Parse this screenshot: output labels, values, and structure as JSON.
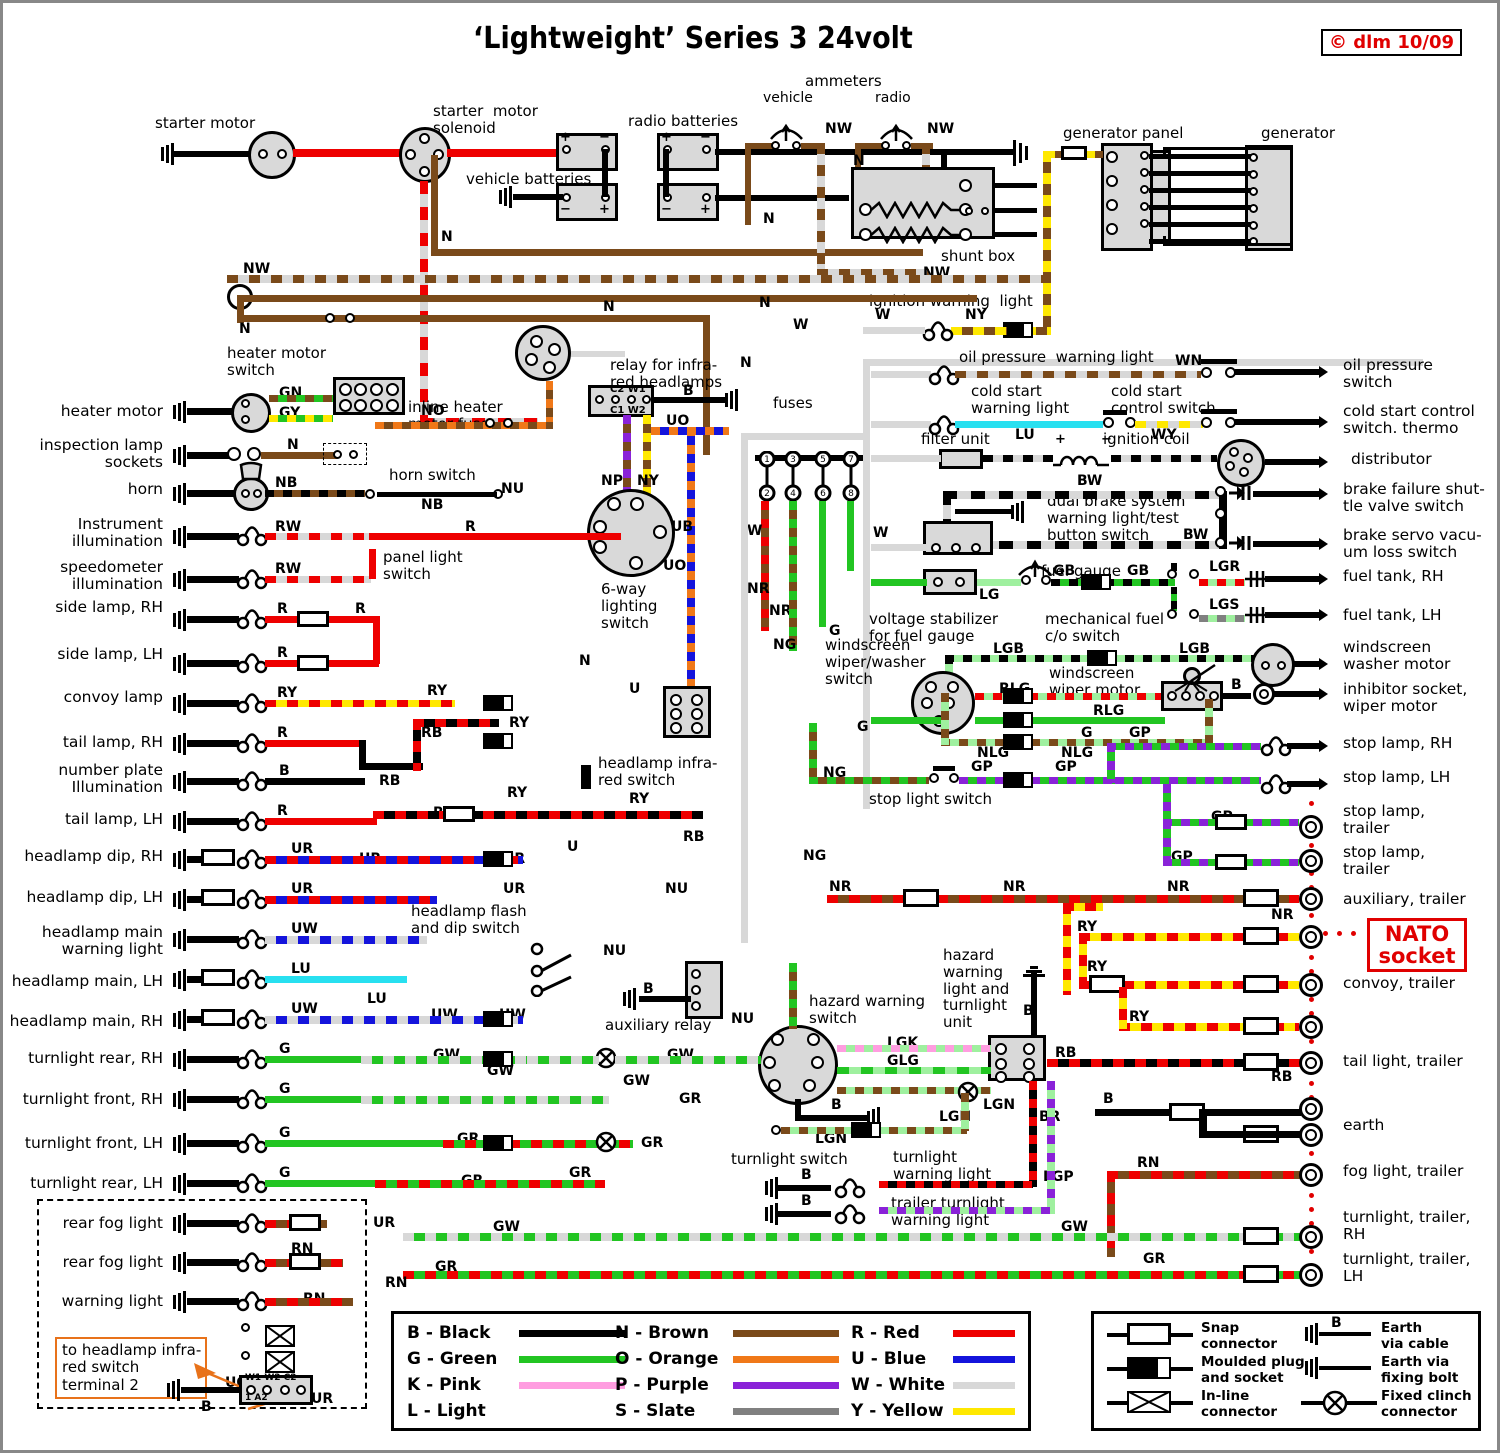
{
  "title": "‘Lightweight’ Series 3 24volt",
  "copyright": "© dlm 10/09",
  "top_components": {
    "starter_motor": "starter motor",
    "starter_motor_solenoid": "starter  motor\nsolenoid",
    "vehicle_batteries": "vehicle batteries",
    "radio_batteries": "radio batteries",
    "ammeters": "ammeters",
    "ammeter_vehicle": "vehicle",
    "ammeter_radio": "radio",
    "shunt_box": "shunt box",
    "generator_panel": "generator panel",
    "generator": "generator",
    "ignition_warning_light": "ignition warning  light"
  },
  "left_labels": [
    "heater motor",
    "inspection lamp\nsockets",
    "horn",
    "Instrument\nillumination",
    "speedometer\nillumination",
    "side lamp, RH",
    "side lamp, LH",
    "convoy lamp",
    "tail lamp, RH",
    "number plate\nIllumination",
    "tail lamp, LH",
    "headlamp dip, RH",
    "headlamp dip, LH",
    "headlamp main\nwarning light",
    "headlamp main, LH",
    "headlamp main, RH",
    "turnlight rear, RH",
    "turnlight front, RH",
    "turnlight front, LH",
    "turnlight rear, LH",
    "rear fog light",
    "rear fog light",
    "warning light"
  ],
  "right_labels": [
    "oil pressure\nswitch",
    "cold start control\nswitch. thermo",
    "distributor",
    "brake failure shut-\ntle valve switch",
    "brake servo vacu-\num loss switch",
    "fuel tank, RH",
    "fuel tank, LH",
    "windscreen\nwasher motor",
    "inhibitor socket,\nwiper motor",
    "stop lamp, RH",
    "stop lamp, LH",
    "stop lamp,\ntrailer",
    "stop lamp,\ntrailer",
    "auxiliary, trailer",
    "convoy, trailer",
    "tail light, trailer",
    "earth",
    "fog light, trailer",
    "turnlight, trailer,\nRH",
    "turnlight, trailer,\nLH"
  ],
  "nato_socket": "NATO\nsocket",
  "center_components": [
    "heater motor\nswitch",
    "inline heater\nmotor fuse",
    "relay for infra-\nred headlamps",
    "horn switch",
    "panel light\nswitch",
    "6-way\nlighting\nswitch",
    "headlamp infra-\nred switch",
    "fuses",
    "headlamp flash\nand dip switch",
    "auxiliary relay",
    "hazard warning\nswitch",
    "hazard\nwarning\nlight and\nturnlight\nunit",
    "turnlight switch",
    "turnlight\nwarning light",
    "trailer turnlight\nwarning light",
    "oil pressure  warning light",
    "cold start\nwarning light",
    "cold start\ncontrol switch",
    "filter unit",
    "ignition coil",
    "dual brake system\nwarning light/test\nbutton switch",
    "fuel gauge",
    "voltage stabilizer\nfor fuel gauge",
    "mechanical fuel\nc/o switch",
    "windscreen\nwiper/washer\nswitch",
    "windscreen\nwiper motor",
    "stop light switch"
  ],
  "callout": "to headlamp infra-\nred switch\nterminal 2",
  "wire_codes": [
    "NW",
    "N",
    "N",
    "N",
    "NW",
    "NW",
    "N",
    "N",
    "W",
    "W",
    "NY",
    "W",
    "WN",
    "W",
    "LU",
    "WY",
    "W",
    "W",
    "BW",
    "BW",
    "GN",
    "GY",
    "NO",
    "NB",
    "NB",
    "NU",
    "RW",
    "RW",
    "R",
    "R",
    "R",
    "R",
    "R",
    "R",
    "RY",
    "RY",
    "RY",
    "RY",
    "RY",
    "R",
    "RB",
    "RB",
    "RB",
    "RB",
    "B",
    "NP",
    "NY",
    "NY",
    "NY",
    "UO",
    "UO",
    "UB",
    "U",
    "U",
    "B",
    "B",
    "NR",
    "NG",
    "NG",
    "NR",
    "NR",
    "NR",
    "NR",
    "W",
    "W",
    "W",
    "UR",
    "UR",
    "UR",
    "UR",
    "UW",
    "UW",
    "UW",
    "UW",
    "LU",
    "NU",
    "NU",
    "NU",
    "NU",
    "G",
    "G",
    "G",
    "G",
    "GW",
    "GW",
    "GW",
    "GW",
    "GR",
    "GR",
    "GR",
    "GR",
    "GR",
    "LG",
    "GB",
    "GB",
    "LGR",
    "LGS",
    "LGB",
    "LGB",
    "RLG",
    "RLG",
    "G",
    "NLG",
    "NLG",
    "G",
    "GP",
    "GP",
    "GP",
    "GP",
    "GP",
    "LGK",
    "LGLG",
    "LGN",
    "LGN",
    "LGN",
    "BR",
    "RB",
    "RB",
    "RN",
    "RN",
    "RN",
    "UO",
    "UR",
    "UR",
    "B",
    "B",
    "B",
    "B",
    "B"
  ],
  "color_legend": {
    "title": "",
    "entries": [
      {
        "code": "B - Black",
        "color": "#000000"
      },
      {
        "code": "G - Green",
        "color": "#22c522"
      },
      {
        "code": "K - Pink",
        "color": "#ff9de0"
      },
      {
        "code": "L - Light",
        "color": null
      },
      {
        "code": "N - Brown",
        "color": "#7a4a1a"
      },
      {
        "code": "O - Orange",
        "color": "#f07818"
      },
      {
        "code": "P - Purple",
        "color": "#8a22d8"
      },
      {
        "code": "S - Slate",
        "color": "#808080"
      },
      {
        "code": "R - Red",
        "color": "#ee0000"
      },
      {
        "code": "U - Blue",
        "color": "#1414dc"
      },
      {
        "code": "W - White",
        "color": "#d8d8d8"
      },
      {
        "code": "Y - Yellow",
        "color": "#ffe800"
      }
    ]
  },
  "symbol_legend": {
    "entries": [
      {
        "name": "snap-connector",
        "label": "Snap\nconnector"
      },
      {
        "name": "moulded-plug",
        "label": "Moulded plug\nand socket"
      },
      {
        "name": "inline-connector",
        "label": "In-line\nconnector"
      },
      {
        "name": "earth-via-cable",
        "label": "Earth\nvia cable",
        "code": "B"
      },
      {
        "name": "earth-fixing-bolt",
        "label": "Earth via\nfixing bolt"
      },
      {
        "name": "fixed-clinch",
        "label": "Fixed clinch\nconnector"
      }
    ]
  },
  "battery_marks": {
    "plus": "+",
    "minus": "−"
  },
  "relay_pins": [
    "C2",
    "W1",
    "C1",
    "W2"
  ],
  "fuse_numbers": [
    "1",
    "2",
    "3",
    "4",
    "5",
    "6",
    "7",
    "8"
  ],
  "colors": {
    "black": "#000000",
    "red": "#ee0000",
    "brown": "#7a4a1a",
    "blue": "#1414dc",
    "green": "#22c522",
    "lightgreen": "#9ff09f",
    "yellow": "#ffe800",
    "white": "#d8d8d8",
    "orange": "#f07818",
    "purple": "#8a22d8",
    "pink": "#ff9de0",
    "slate": "#808080",
    "lightblue": "#28e0f0",
    "accent_red": "#e00000",
    "accent_orange": "#e8721a",
    "panel_fill": "#d9d9d9"
  }
}
